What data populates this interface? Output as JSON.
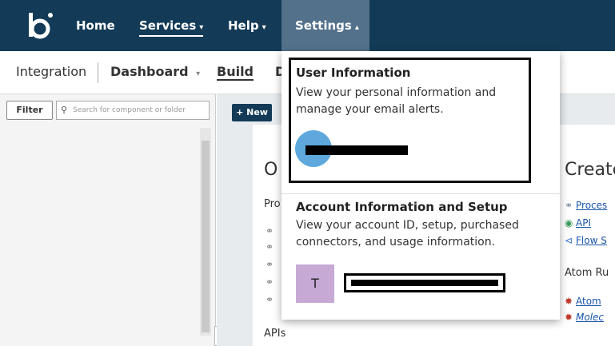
{
  "topnav": {
    "home": "Home",
    "services": "Services",
    "help": "Help",
    "settings": "Settings",
    "caret_down": "▾",
    "caret_up": "▴"
  },
  "subnav": {
    "integration": "Integration",
    "dashboard": "Dashboard",
    "build": "Build",
    "partial": "D"
  },
  "left": {
    "filter": "Filter",
    "search_placeholder": "Search for component or folder",
    "collapse": "‹"
  },
  "main": {
    "new_button": "+ New",
    "card_heading_left": "O",
    "card_sub_left": "Pro",
    "apis_label": "APIs",
    "card_heading_right": "Create",
    "links": [
      "Proces",
      "API",
      "Flow S"
    ],
    "atom_label": "Atom Ru",
    "atom_links": [
      "Atom",
      "Molec"
    ]
  },
  "dropdown": {
    "user_info_title": "User Information",
    "user_info_desc": "View your personal information and manage your email alerts.",
    "account_title": "Account Information and Setup",
    "account_desc": "View your account ID, setup, purchased connectors, and usage information.",
    "account_avatar_initial": "T"
  }
}
